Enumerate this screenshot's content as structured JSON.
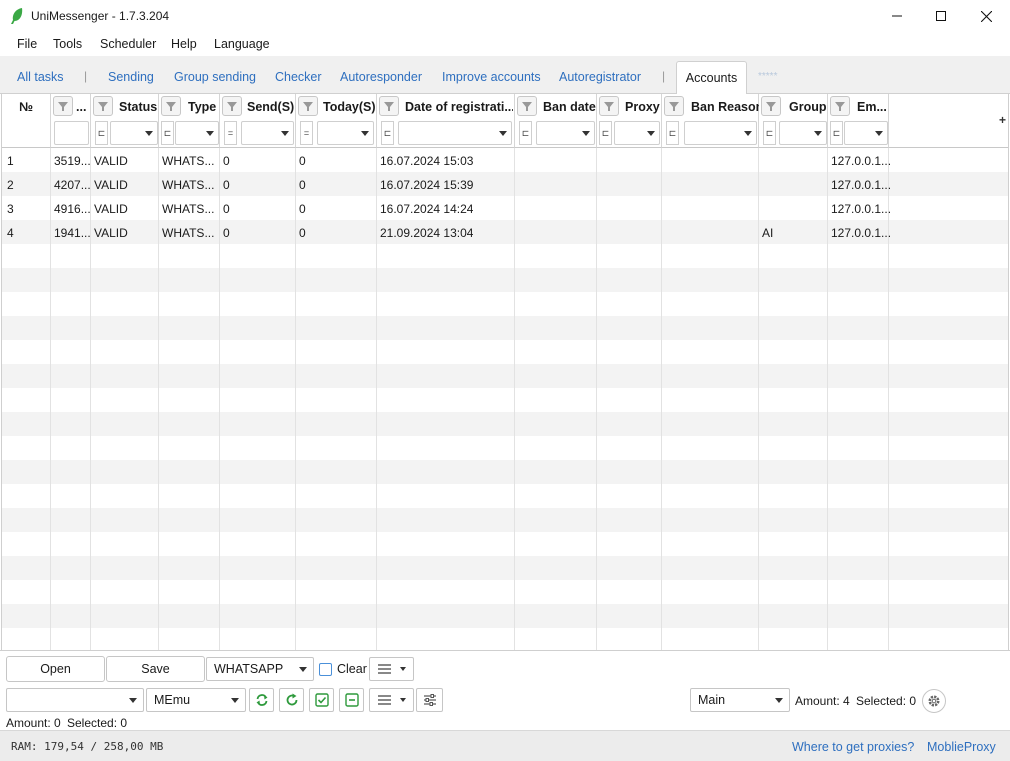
{
  "window": {
    "title": "UniMessenger - 1.7.3.204"
  },
  "menu": [
    "File",
    "Tools",
    "Scheduler",
    "Help",
    "Language"
  ],
  "tabs": [
    "All tasks",
    "Sending",
    "Group sending",
    "Checker",
    "Autoresponder",
    "Improve accounts",
    "Autoregistrator",
    "Accounts",
    "*****"
  ],
  "table": {
    "columns": [
      "№",
      "...",
      "Status",
      "Type",
      "Send(S)",
      "Today(S)",
      "Date of registrati...",
      "Ban date",
      "Proxy",
      "Ban Reason",
      "Group",
      "Em..."
    ],
    "filter_ops": [
      "⊏",
      "⊏",
      "=",
      "=",
      "⊏",
      "⊏",
      "⊏",
      "⊏",
      "⊏",
      "⊏"
    ],
    "rows": [
      [
        "1",
        "3519...",
        "VALID",
        "WHATS...",
        "0",
        "0",
        "16.07.2024 15:03",
        "",
        "",
        "",
        "",
        "127.0.0.1..."
      ],
      [
        "2",
        "4207...",
        "VALID",
        "WHATS...",
        "0",
        "0",
        "16.07.2024 15:39",
        "",
        "",
        "",
        "",
        "127.0.0.1..."
      ],
      [
        "3",
        "4916...",
        "VALID",
        "WHATS...",
        "0",
        "0",
        "16.07.2024 14:24",
        "",
        "",
        "",
        "",
        "127.0.0.1..."
      ],
      [
        "4",
        "1941...",
        "VALID",
        "WHATS...",
        "0",
        "0",
        "21.09.2024 13:04",
        "",
        "",
        "",
        "AI",
        "127.0.0.1..."
      ]
    ],
    "add_column": "+"
  },
  "toolbar": {
    "open": "Open",
    "save": "Save",
    "type_combo": "WHATSAPP",
    "clear": "Clear",
    "emulator_combo": "MEmu",
    "group_combo": "Main",
    "amount_right": "Amount: 4",
    "selected_right": "Selected: 0",
    "amount_left": "Amount: 0",
    "selected_left": "Selected: 0"
  },
  "footer": {
    "ram": "RAM: 179,54 / 258,00 MB",
    "link1": "Where to get proxies?",
    "link2": "MoblieProxy"
  },
  "colors": {
    "accent": "#2e6fbf",
    "green": "#2e9a3c",
    "row_alt": "#f3f3f3"
  }
}
